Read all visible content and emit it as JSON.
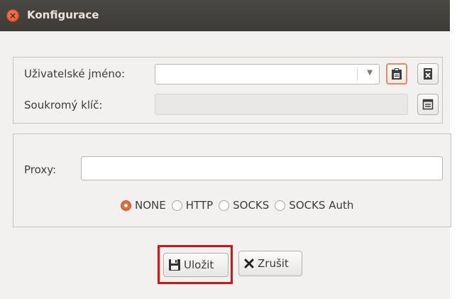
{
  "window": {
    "title": "Konfigurace",
    "close_glyph": "×"
  },
  "credentials": {
    "username_label": "Uživatelské jméno:",
    "username_value": "",
    "private_key_label": "Soukromý klíč:",
    "private_key_value": "",
    "icons": [
      "chevron-down-icon",
      "clipboard-icon",
      "delete-icon",
      "file-icon"
    ]
  },
  "proxy": {
    "label": "Proxy:",
    "value": "",
    "options": [
      "NONE",
      "HTTP",
      "SOCKS",
      "SOCKS Auth"
    ],
    "selected": "NONE"
  },
  "actions": {
    "save_label": "Uložit",
    "cancel_label": "Zrušit"
  },
  "colors": {
    "accent": "#e46a3d",
    "highlight": "#e01010"
  }
}
